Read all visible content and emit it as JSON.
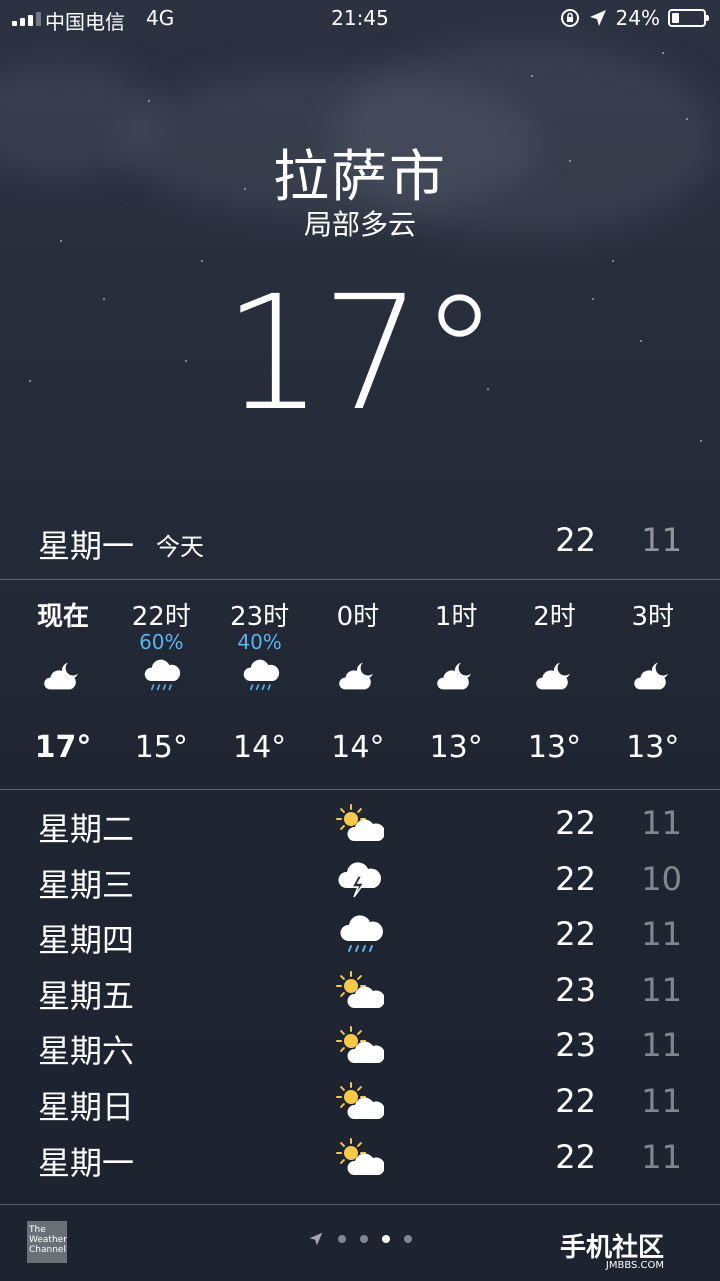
{
  "status_bar": {
    "carrier": "中国电信",
    "network": "4G",
    "time": "21:45",
    "battery_percent": "24%",
    "battery_level": 0.24
  },
  "location": {
    "city": "拉萨市",
    "condition": "局部多云",
    "temperature": "17°"
  },
  "today": {
    "day": "星期一",
    "label": "今天",
    "high": "22",
    "low": "11"
  },
  "hourly": [
    {
      "time": "现在",
      "precip": "",
      "icon": "partly-cloudy-night-icon",
      "temp": "17°"
    },
    {
      "time": "22时",
      "precip": "60%",
      "icon": "rain-icon",
      "temp": "15°"
    },
    {
      "time": "23时",
      "precip": "40%",
      "icon": "rain-icon",
      "temp": "14°"
    },
    {
      "time": "0时",
      "precip": "",
      "icon": "partly-cloudy-night-icon",
      "temp": "14°"
    },
    {
      "time": "1时",
      "precip": "",
      "icon": "partly-cloudy-night-icon",
      "temp": "13°"
    },
    {
      "time": "2时",
      "precip": "",
      "icon": "partly-cloudy-night-icon",
      "temp": "13°"
    },
    {
      "time": "3时",
      "precip": "",
      "icon": "partly-cloudy-night-icon",
      "temp": "13°"
    }
  ],
  "daily": [
    {
      "day": "星期二",
      "icon": "partly-sunny-icon",
      "high": "22",
      "low": "11"
    },
    {
      "day": "星期三",
      "icon": "thunderstorm-icon",
      "high": "22",
      "low": "10"
    },
    {
      "day": "星期四",
      "icon": "rain-icon",
      "high": "22",
      "low": "11"
    },
    {
      "day": "星期五",
      "icon": "partly-sunny-icon",
      "high": "23",
      "low": "11"
    },
    {
      "day": "星期六",
      "icon": "partly-sunny-icon",
      "high": "23",
      "low": "11"
    },
    {
      "day": "星期日",
      "icon": "partly-sunny-icon",
      "high": "22",
      "low": "11"
    },
    {
      "day": "星期一",
      "icon": "partly-sunny-icon",
      "high": "22",
      "low": "11"
    }
  ],
  "footer": {
    "provider_logo": "The Weather Channel",
    "page_count": 4,
    "active_page": 3,
    "watermark": "手机社区",
    "watermark_sub": "JMBBS.COM"
  },
  "colors": {
    "precip": "#5ab4f0",
    "sun": "#f7c948",
    "background": "#252c39"
  }
}
